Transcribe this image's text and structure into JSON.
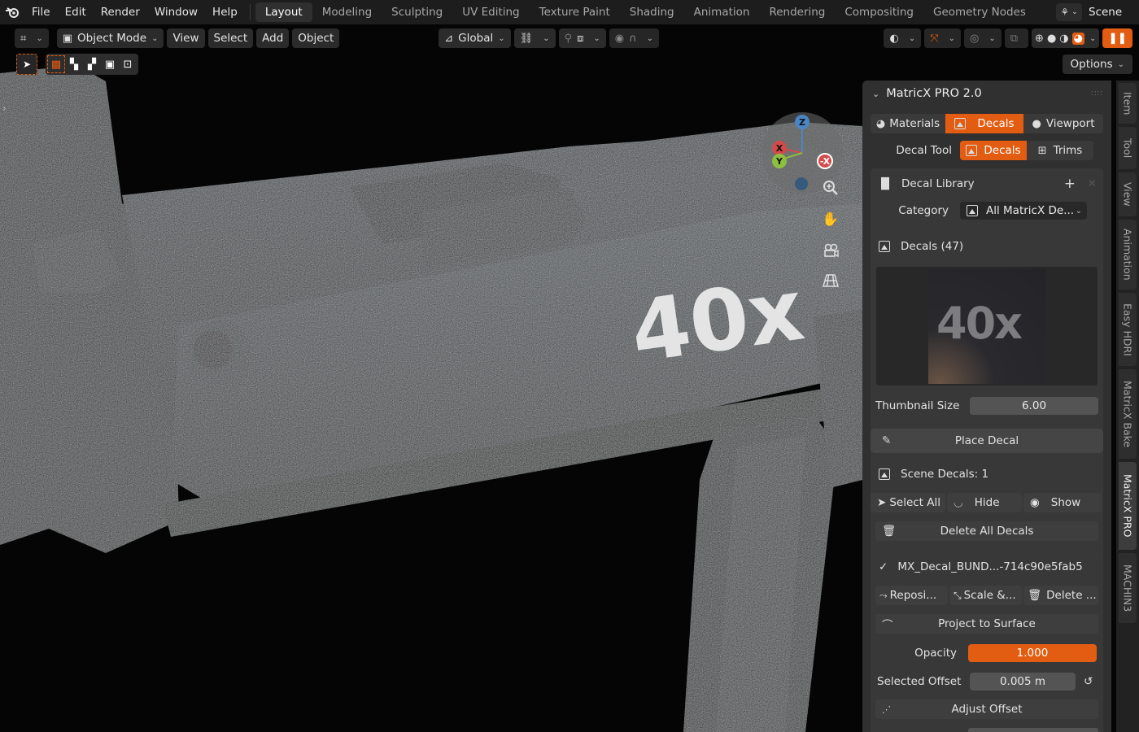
{
  "menu": [
    "File",
    "Edit",
    "Render",
    "Window",
    "Help"
  ],
  "workspaces": [
    "Layout",
    "Modeling",
    "Sculpting",
    "UV Editing",
    "Texture Paint",
    "Shading",
    "Animation",
    "Rendering",
    "Compositing",
    "Geometry Nodes"
  ],
  "scene_label": "Scene",
  "header": {
    "mode": "Object Mode",
    "menus": [
      "View",
      "Select",
      "Add",
      "Object"
    ],
    "transform": "Global",
    "options": "Options"
  },
  "model_text": "40x",
  "panel": {
    "title": "MatricX PRO 2.0",
    "tabs": [
      "Materials",
      "Decals",
      "Viewport"
    ],
    "decal_tool_label": "Decal Tool",
    "decal_tool_opts": [
      "Decals",
      "Trims"
    ],
    "library_label": "Decal Library",
    "category_label": "Category",
    "category_value": "All MatricX De...",
    "decals_count": "Decals (47)",
    "thumb_text": "40x",
    "thumb_size_label": "Thumbnail Size",
    "thumb_size_value": "6.00",
    "place_decal": "Place Decal",
    "scene_decals": "Scene Decals: 1",
    "select_all": "Select All",
    "hide": "Hide",
    "show": "Show",
    "delete_all": "Delete All Decals",
    "decal_name": "MX_Decal_BUND...-714c90e5fab5",
    "reposition": "Reposi...",
    "scale": "Scale &...",
    "delete": "Delete ...",
    "project": "Project to Surface",
    "opacity_label": "Opacity",
    "opacity_value": "1.000",
    "offset_label": "Selected Offset",
    "offset_value": "0.005 m",
    "adjust_offset": "Adjust Offset"
  },
  "side_tabs": [
    "Item",
    "Tool",
    "View",
    "Animation",
    "Easy HDRI",
    "MatricX Bake",
    "MatricX PRO",
    "MACHIN3"
  ],
  "gizmo": {
    "z": "Z",
    "x": "X",
    "neg_x": "-X",
    "y": "Y"
  }
}
